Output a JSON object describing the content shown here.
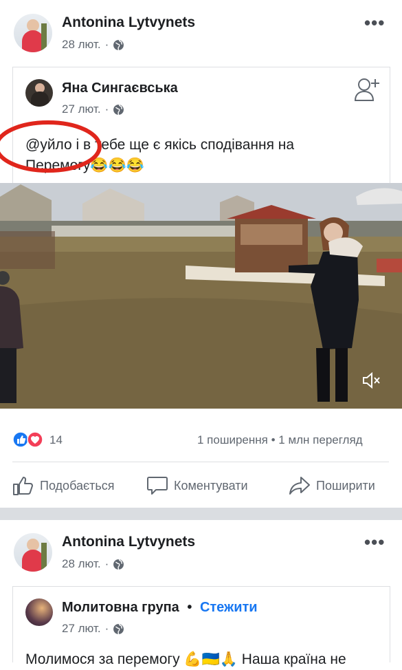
{
  "post1": {
    "author": "Antonina Lytvynets",
    "date": "28 лют.",
    "shared": {
      "author": "Яна Сингаєвська",
      "date": "27 лют.",
      "text_line1": "@уйло і в тебе ще є якісь сподівання на",
      "text_line2": "Перемогу",
      "emojis": "😂😂😂"
    },
    "reactions_count": "14",
    "shares_views": "1 поширення • 1 млн перегляд",
    "actions": {
      "like": "Подобається",
      "comment": "Коментувати",
      "share": "Поширити"
    }
  },
  "post2": {
    "author": "Antonina Lytvynets",
    "date": "28 лют.",
    "shared": {
      "author": "Молитовна група",
      "separator": "•",
      "follow": "Стежити",
      "date": "27 лют.",
      "text_partial": "Молимося за перемогу 💪🇺🇦🙏 Наша країна не"
    }
  },
  "colors": {
    "accent": "#1877f2",
    "annotation_circle": "#e0261c",
    "like_blue": "#1877f2",
    "love_red": "#f33e58"
  },
  "icons": [
    "globe-icon",
    "add-friend-icon",
    "mute-icon",
    "like-icon",
    "comment-icon",
    "share-icon",
    "more-icon"
  ]
}
